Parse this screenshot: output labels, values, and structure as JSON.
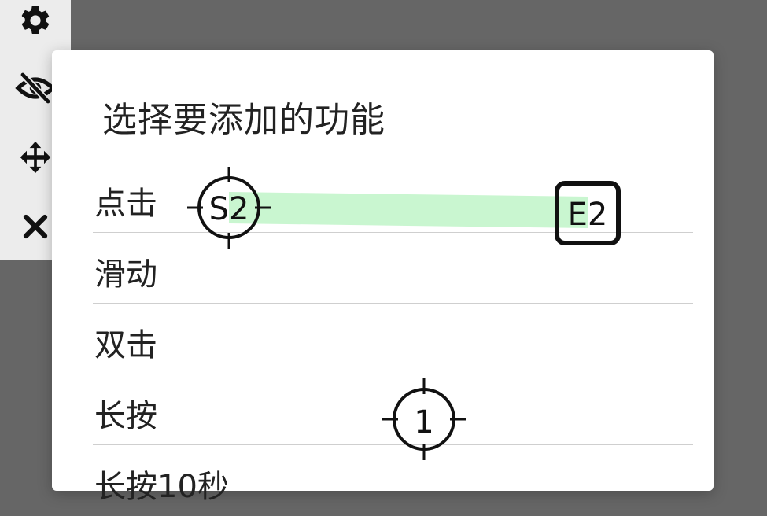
{
  "toolbar": {
    "items": [
      {
        "icon": "gear-icon"
      },
      {
        "icon": "eye-off-icon"
      },
      {
        "icon": "move-icon"
      },
      {
        "icon": "close-icon"
      }
    ]
  },
  "dialog": {
    "title": "选择要添加的功能",
    "options": [
      {
        "label": "点击"
      },
      {
        "label": "滑动"
      },
      {
        "label": "双击"
      },
      {
        "label": "长按"
      },
      {
        "label": "长按10秒"
      }
    ]
  },
  "markers": {
    "swipe_start": "S2",
    "swipe_end": "E2",
    "tap_point": "1",
    "swipe_color": "#bff5c8"
  }
}
